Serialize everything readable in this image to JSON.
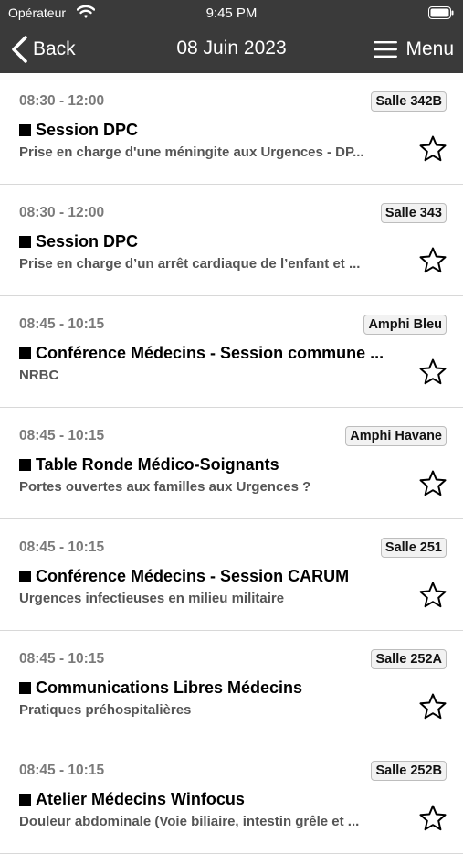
{
  "status": {
    "carrier": "Opérateur",
    "time": "9:45 PM"
  },
  "nav": {
    "back_label": "Back",
    "title": "08 Juin 2023",
    "menu_label": "Menu"
  },
  "sessions": [
    {
      "time": "08:30 - 12:00",
      "room": "Salle 342B",
      "title": "Session DPC",
      "subtitle": "Prise en charge d'une méningite aux Urgences - DP..."
    },
    {
      "time": "08:30 - 12:00",
      "room": "Salle 343",
      "title": "Session DPC",
      "subtitle": "Prise en charge d’un arrêt cardiaque de l’enfant et ..."
    },
    {
      "time": "08:45 - 10:15",
      "room": "Amphi Bleu",
      "title": "Conférence Médecins - Session commune ...",
      "subtitle": "NRBC"
    },
    {
      "time": "08:45 - 10:15",
      "room": "Amphi Havane",
      "title": "Table Ronde Médico-Soignants",
      "subtitle": "Portes ouvertes aux familles aux Urgences ?"
    },
    {
      "time": "08:45 - 10:15",
      "room": "Salle 251",
      "title": "Conférence Médecins - Session CARUM",
      "subtitle": "Urgences infectieuses en milieu militaire"
    },
    {
      "time": "08:45 - 10:15",
      "room": "Salle 252A",
      "title": "Communications Libres Médecins",
      "subtitle": "Pratiques préhospitalières"
    },
    {
      "time": "08:45 - 10:15",
      "room": "Salle 252B",
      "title": "Atelier Médecins Winfocus",
      "subtitle": "Douleur abdominale (Voie biliaire, intestin grêle et ..."
    }
  ]
}
